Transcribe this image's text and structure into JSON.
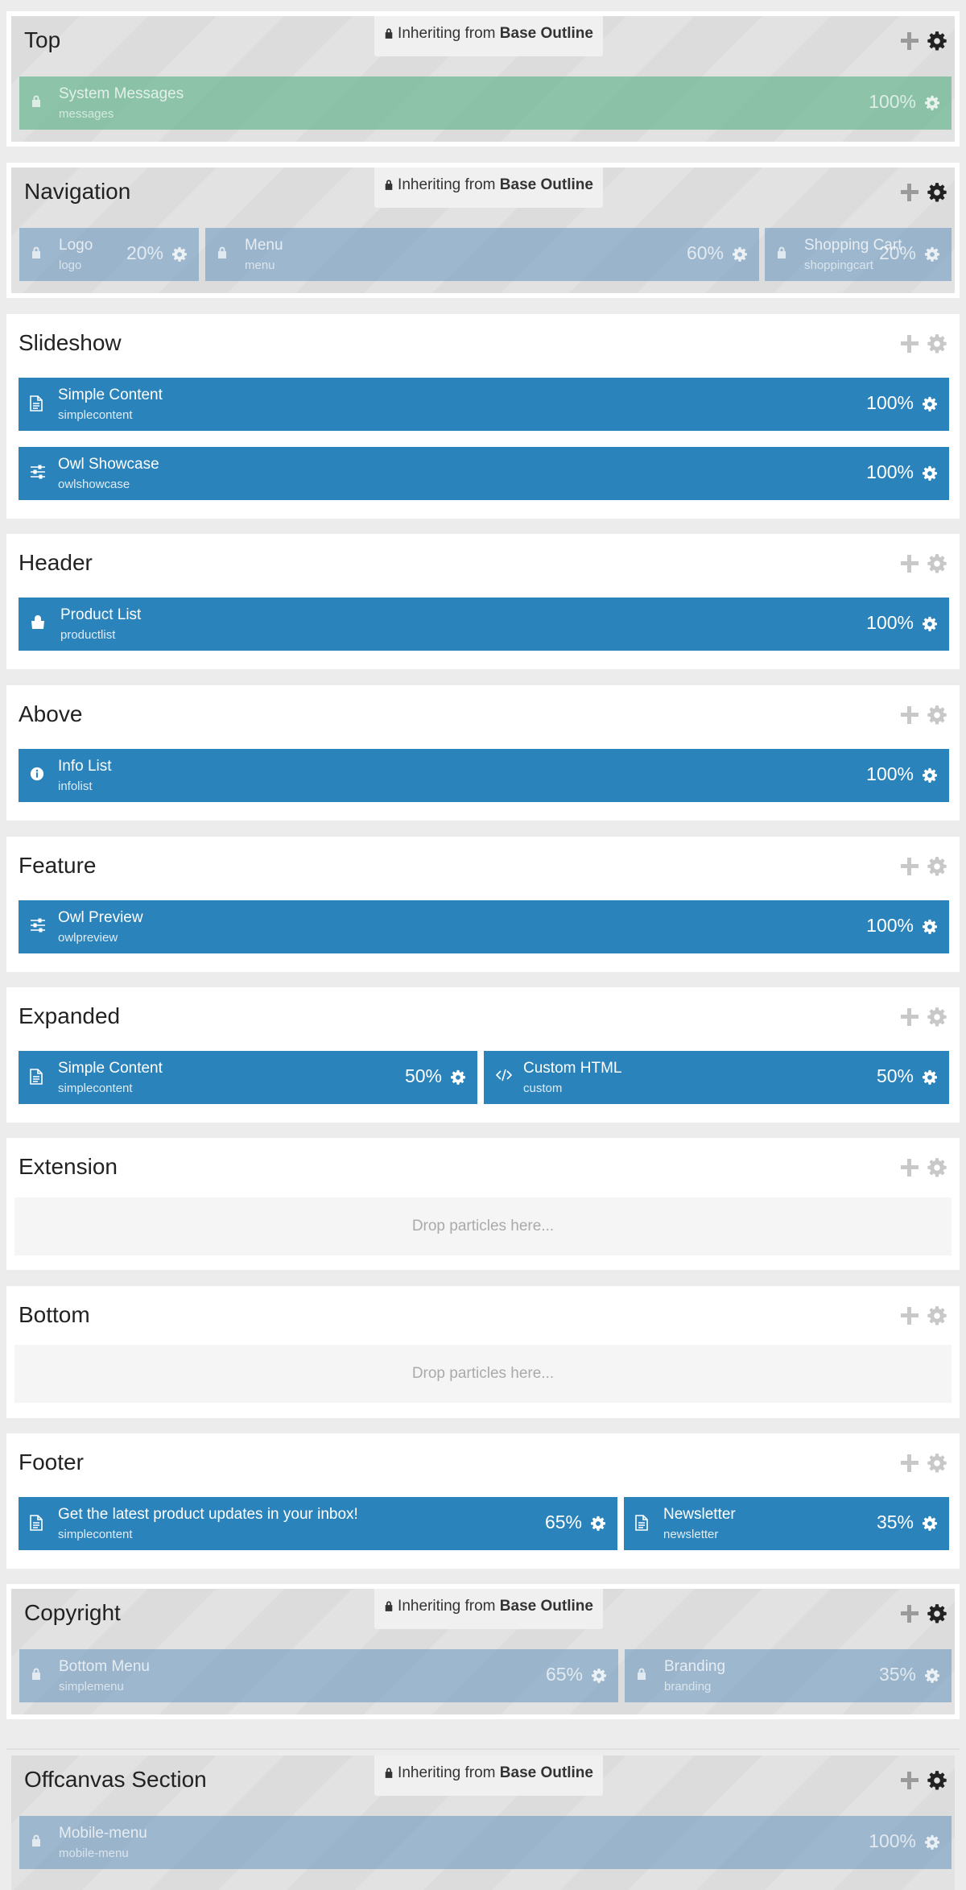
{
  "colors": {
    "particle_blue": "#2a83bb",
    "faded_blue": "#6496be",
    "system_green": "#70ba96",
    "panel_gray": "#dcdcdc"
  },
  "inherit": {
    "prefix": "Inheriting from",
    "outline": "Base Outline"
  },
  "drop_text": "Drop particles here...",
  "sections": {
    "top": {
      "title": "Top",
      "particles": [
        {
          "name": "System Messages",
          "sub": "messages",
          "pct": "100%",
          "icon": "lock-icon"
        }
      ]
    },
    "navigation": {
      "title": "Navigation",
      "particles": [
        {
          "name": "Logo",
          "sub": "logo",
          "pct": "20%",
          "icon": "lock-icon"
        },
        {
          "name": "Menu",
          "sub": "menu",
          "pct": "60%",
          "icon": "lock-icon"
        },
        {
          "name": "Shopping Cart",
          "sub": "shoppingcart",
          "pct": "20%",
          "icon": "lock-icon"
        }
      ]
    },
    "slideshow": {
      "title": "Slideshow",
      "particles": [
        {
          "name": "Simple Content",
          "sub": "simplecontent",
          "pct": "100%",
          "icon": "document-icon"
        },
        {
          "name": "Owl Showcase",
          "sub": "owlshowcase",
          "pct": "100%",
          "icon": "sliders-icon"
        }
      ]
    },
    "header": {
      "title": "Header",
      "particles": [
        {
          "name": "Product List",
          "sub": "productlist",
          "pct": "100%",
          "icon": "shopping-bag-icon"
        }
      ]
    },
    "above": {
      "title": "Above",
      "particles": [
        {
          "name": "Info List",
          "sub": "infolist",
          "pct": "100%",
          "icon": "info-icon"
        }
      ]
    },
    "feature": {
      "title": "Feature",
      "particles": [
        {
          "name": "Owl Preview",
          "sub": "owlpreview",
          "pct": "100%",
          "icon": "sliders-icon"
        }
      ]
    },
    "expanded": {
      "title": "Expanded",
      "particles": [
        {
          "name": "Simple Content",
          "sub": "simplecontent",
          "pct": "50%",
          "icon": "document-icon"
        },
        {
          "name": "Custom HTML",
          "sub": "custom",
          "pct": "50%",
          "icon": "code-icon"
        }
      ]
    },
    "extension": {
      "title": "Extension"
    },
    "bottom": {
      "title": "Bottom"
    },
    "footer": {
      "title": "Footer",
      "particles": [
        {
          "name": "Get the latest product updates in your inbox!",
          "sub": "simplecontent",
          "pct": "65%",
          "icon": "document-icon"
        },
        {
          "name": "Newsletter",
          "sub": "newsletter",
          "pct": "35%",
          "icon": "document-icon"
        }
      ]
    },
    "copyright": {
      "title": "Copyright",
      "particles": [
        {
          "name": "Bottom Menu",
          "sub": "simplemenu",
          "pct": "65%",
          "icon": "lock-icon"
        },
        {
          "name": "Branding",
          "sub": "branding",
          "pct": "35%",
          "icon": "lock-icon"
        }
      ]
    },
    "offcanvas": {
      "title": "Offcanvas Section",
      "particles": [
        {
          "name": "Mobile-menu",
          "sub": "mobile-menu",
          "pct": "100%",
          "icon": "lock-icon"
        }
      ]
    }
  }
}
